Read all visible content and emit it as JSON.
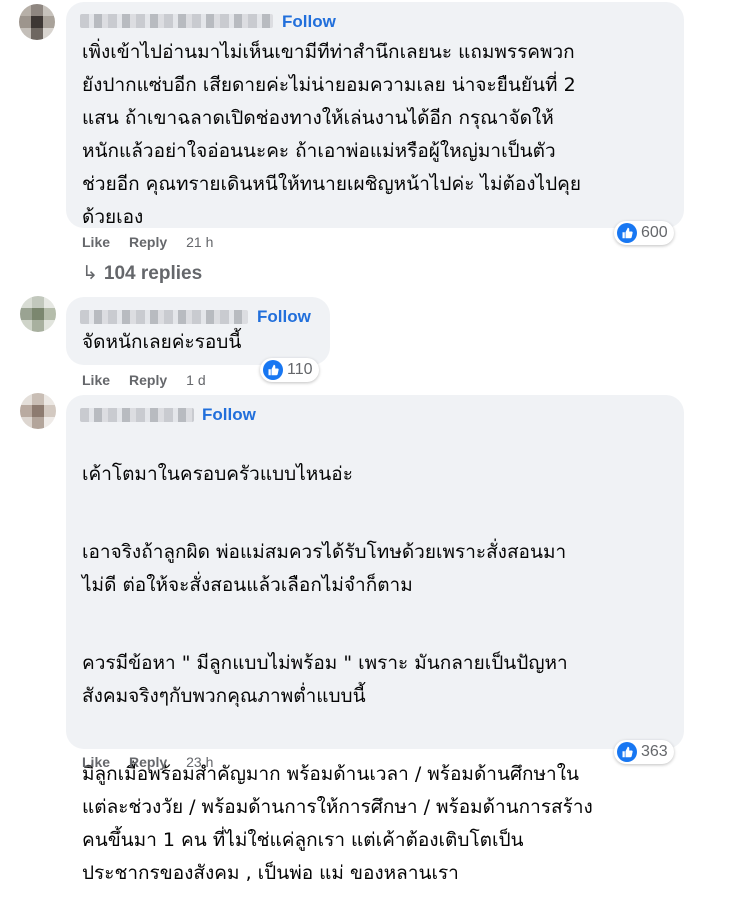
{
  "comments": [
    {
      "follow_label": "Follow",
      "text": "เพิ่งเข้าไปอ่านมาไม่เห็นเขามีทีท่าสำนึกเลยนะ แถมพรรคพวก\nยังปากแซ่บอีก เสียดายค่ะไม่น่ายอมความเลย น่าจะยืนยันที่ 2\nแสน ถ้าเขาฉลาดเปิดช่องทางให้เล่นงานได้อีก กรุณาจัดให้\nหนักแล้วอย่าใจอ่อนนะคะ ถ้าเอาพ่อแม่หรือผู้ใหญ่มาเป็นตัว\nช่วยอีก คุณทรายเดินหนีให้ทนายเผชิญหน้าไปค่ะ ไม่ต้องไปคุย\nด้วยเอง",
      "like_label": "Like",
      "reply_label": "Reply",
      "time": "21 h",
      "reaction_count": "600",
      "replies_label": "104 replies"
    },
    {
      "follow_label": "Follow",
      "text": "จัดหนักเลยค่ะรอบนี้",
      "like_label": "Like",
      "reply_label": "Reply",
      "time": "1 d",
      "reaction_count": "110"
    },
    {
      "follow_label": "Follow",
      "paragraphs": [
        "เค้าโตมาในครอบครัวแบบไหนอ่ะ",
        "เอาจริงถ้าลูกผิด พ่อแม่สมควรได้รับโทษด้วยเพราะสั่งสอนมา\nไม่ดี ต่อให้จะสั่งสอนแล้วเลือกไม่จำก็ตาม",
        "ควรมีข้อหา \" มีลูกแบบไม่พร้อม \" เพราะ มันกลายเป็นปัญหา\nสังคมจริงๆกับพวกคุณภาพต่ำแบบนี้",
        "มีลูกเมื่อพร้อมสำคัญมาก พร้อมด้านเวลา / พร้อมด้านศึกษาใน\nแต่ละช่วงวัย / พร้อมด้านการให้การศึกษา / พร้อมด้านการสร้าง\nคนขึ้นมา 1 คน ที่ไม่ใช่แค่ลูกเรา แต่เค้าต้องเติบโตเป็น\nประชากรของสังคม , เป็นพ่อ แม่ ของหลานเรา"
      ],
      "like_label": "Like",
      "reply_label": "Reply",
      "time": "23 h",
      "reaction_count": "363"
    }
  ],
  "icons": {
    "like_reaction": "thumbs-up-icon",
    "replies_arrow": "reply-arrow-icon"
  },
  "colors": {
    "bubble": "#f0f2f5",
    "follow": "#216fdb",
    "like_blue": "#1877f2",
    "meta_gray": "#65676b"
  }
}
